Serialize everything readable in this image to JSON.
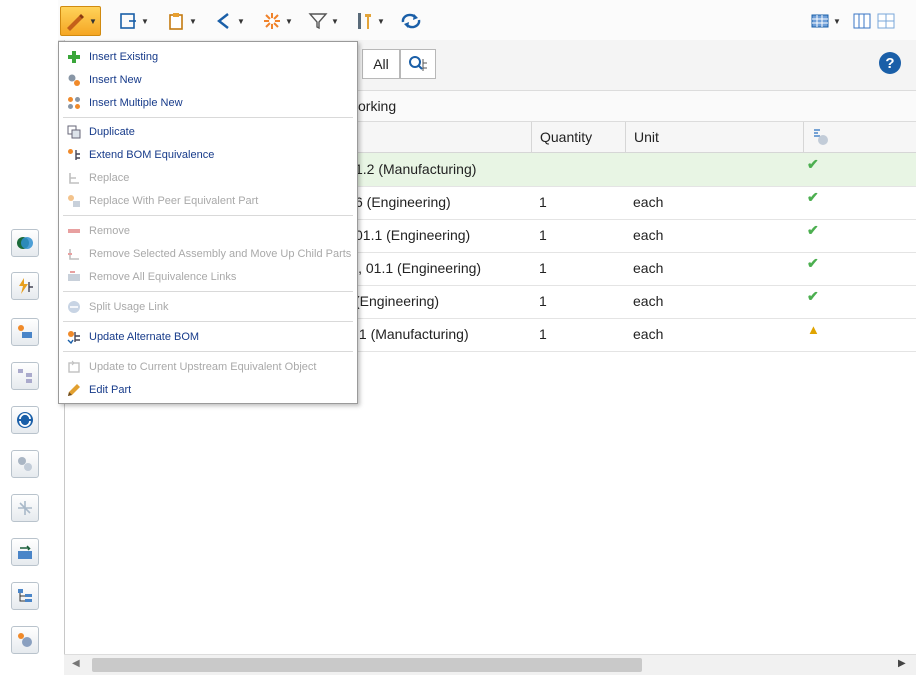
{
  "toolbar": {
    "icons": [
      "edit-pencil-icon",
      "insert-icon",
      "paste-icon",
      "compare-icon",
      "configure-icon",
      "filter-icon",
      "tools-icon",
      "sync-icon",
      "layout-icon",
      "columns-icon",
      "tiles-icon"
    ]
  },
  "filter": {
    "all_label": "All",
    "view_text": "orking"
  },
  "table": {
    "columns": {
      "quantity": "Quantity",
      "unit": "Unit"
    },
    "rows": [
      {
        "name": "1.2 (Manufacturing)",
        "quantity": "",
        "unit": "",
        "status": "ok"
      },
      {
        "name": "6 (Engineering)",
        "quantity": "1",
        "unit": "each",
        "status": "ok"
      },
      {
        "name": "01.1 (Engineering)",
        "quantity": "1",
        "unit": "each",
        "status": "ok"
      },
      {
        "name": "l, 01.1 (Engineering)",
        "quantity": "1",
        "unit": "each",
        "status": "ok"
      },
      {
        "name": " (Engineering)",
        "quantity": "1",
        "unit": "each",
        "status": "ok"
      },
      {
        "name": ".1 (Manufacturing)",
        "quantity": "1",
        "unit": "each",
        "status": "warning"
      }
    ]
  },
  "menu": {
    "items": [
      {
        "label": "Insert Existing",
        "enabled": true
      },
      {
        "label": "Insert New",
        "enabled": true
      },
      {
        "label": "Insert Multiple New",
        "enabled": true
      },
      {
        "label": "Duplicate",
        "enabled": true
      },
      {
        "label": "Extend BOM Equivalence",
        "enabled": true
      },
      {
        "label": "Replace",
        "enabled": false
      },
      {
        "label": "Replace With Peer Equivalent Part",
        "enabled": false
      },
      {
        "label": "Remove",
        "enabled": false
      },
      {
        "label": "Remove Selected Assembly and Move Up Child Parts",
        "enabled": false
      },
      {
        "label": "Remove All Equivalence Links",
        "enabled": false
      },
      {
        "label": "Split Usage Link",
        "enabled": false
      },
      {
        "label": "Update Alternate BOM",
        "enabled": true
      },
      {
        "label": "Update to Current Upstream Equivalent Object",
        "enabled": false
      },
      {
        "label": "Edit Part",
        "enabled": true
      }
    ]
  },
  "colors": {
    "accent_orange": "#f5a623",
    "selected_row": "#e8f5e4",
    "menu_text": "#173b8a",
    "check_green": "#4caf50"
  }
}
